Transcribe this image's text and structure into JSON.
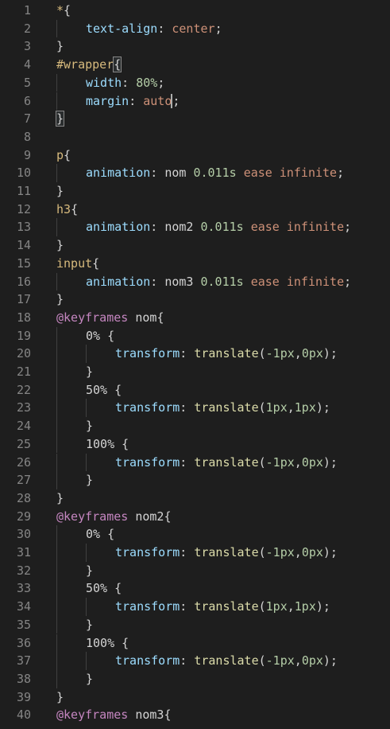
{
  "colors": {
    "background": "#1e1e1e",
    "line_number": "#858585",
    "selector": "#d7ba7d",
    "property": "#9cdcfe",
    "value": "#ce9178",
    "number": "#b5cea8",
    "keyword": "#c586c0",
    "function": "#dcdcaa",
    "punctuation": "#d4d4d4"
  },
  "lines": [
    {
      "n": "1",
      "indent": 0,
      "tokens": [
        [
          "selector",
          "*"
        ],
        [
          "punc",
          "{"
        ]
      ]
    },
    {
      "n": "2",
      "indent": 1,
      "tokens": [
        [
          "prop",
          "text-align"
        ],
        [
          "punc",
          ": "
        ],
        [
          "value",
          "center"
        ],
        [
          "punc",
          ";"
        ]
      ]
    },
    {
      "n": "3",
      "indent": 0,
      "tokens": [
        [
          "punc",
          "}"
        ]
      ]
    },
    {
      "n": "4",
      "indent": 0,
      "tokens": [
        [
          "selector",
          "#wrapper"
        ],
        [
          "punc",
          "{"
        ]
      ],
      "bracket_match": true
    },
    {
      "n": "5",
      "indent": 1,
      "tokens": [
        [
          "prop",
          "width"
        ],
        [
          "punc",
          ": "
        ],
        [
          "number",
          "80%"
        ],
        [
          "punc",
          ";"
        ]
      ]
    },
    {
      "n": "6",
      "indent": 1,
      "tokens": [
        [
          "prop",
          "margin"
        ],
        [
          "punc",
          ": "
        ],
        [
          "value",
          "auto"
        ],
        [
          "punc",
          ";"
        ]
      ],
      "cursor_after": 4
    },
    {
      "n": "7",
      "indent": 0,
      "tokens": [
        [
          "punc",
          "}"
        ]
      ],
      "bracket_match": true
    },
    {
      "n": "8",
      "indent": 0,
      "tokens": []
    },
    {
      "n": "9",
      "indent": 0,
      "tokens": [
        [
          "tag",
          "p"
        ],
        [
          "punc",
          "{"
        ]
      ]
    },
    {
      "n": "10",
      "indent": 1,
      "tokens": [
        [
          "prop",
          "animation"
        ],
        [
          "punc",
          ": "
        ],
        [
          "default",
          "nom "
        ],
        [
          "number",
          "0.011s"
        ],
        [
          "default",
          " "
        ],
        [
          "value",
          "ease"
        ],
        [
          "default",
          " "
        ],
        [
          "value",
          "infinite"
        ],
        [
          "punc",
          ";"
        ]
      ]
    },
    {
      "n": "11",
      "indent": 0,
      "tokens": [
        [
          "punc",
          "}"
        ]
      ]
    },
    {
      "n": "12",
      "indent": 0,
      "tokens": [
        [
          "tag",
          "h3"
        ],
        [
          "punc",
          "{"
        ]
      ]
    },
    {
      "n": "13",
      "indent": 1,
      "tokens": [
        [
          "prop",
          "animation"
        ],
        [
          "punc",
          ": "
        ],
        [
          "default",
          "nom2 "
        ],
        [
          "number",
          "0.011s"
        ],
        [
          "default",
          " "
        ],
        [
          "value",
          "ease"
        ],
        [
          "default",
          " "
        ],
        [
          "value",
          "infinite"
        ],
        [
          "punc",
          ";"
        ]
      ]
    },
    {
      "n": "14",
      "indent": 0,
      "tokens": [
        [
          "punc",
          "}"
        ]
      ]
    },
    {
      "n": "15",
      "indent": 0,
      "tokens": [
        [
          "tag",
          "input"
        ],
        [
          "punc",
          "{"
        ]
      ]
    },
    {
      "n": "16",
      "indent": 1,
      "tokens": [
        [
          "prop",
          "animation"
        ],
        [
          "punc",
          ": "
        ],
        [
          "default",
          "nom3 "
        ],
        [
          "number",
          "0.011s"
        ],
        [
          "default",
          " "
        ],
        [
          "value",
          "ease"
        ],
        [
          "default",
          " "
        ],
        [
          "value",
          "infinite"
        ],
        [
          "punc",
          ";"
        ]
      ]
    },
    {
      "n": "17",
      "indent": 0,
      "tokens": [
        [
          "punc",
          "}"
        ]
      ]
    },
    {
      "n": "18",
      "indent": 0,
      "tokens": [
        [
          "keyword",
          "@keyframes"
        ],
        [
          "default",
          " nom"
        ],
        [
          "punc",
          "{"
        ]
      ]
    },
    {
      "n": "19",
      "indent": 1,
      "tokens": [
        [
          "default",
          "0% "
        ],
        [
          "punc",
          "{"
        ]
      ]
    },
    {
      "n": "20",
      "indent": 2,
      "tokens": [
        [
          "prop",
          "transform"
        ],
        [
          "punc",
          ": "
        ],
        [
          "func",
          "translate"
        ],
        [
          "punc",
          "("
        ],
        [
          "number",
          "-1px"
        ],
        [
          "punc",
          ","
        ],
        [
          "number",
          "0px"
        ],
        [
          "punc",
          ");"
        ]
      ]
    },
    {
      "n": "21",
      "indent": 1,
      "tokens": [
        [
          "punc",
          "}"
        ]
      ]
    },
    {
      "n": "22",
      "indent": 1,
      "tokens": [
        [
          "default",
          "50% "
        ],
        [
          "punc",
          "{"
        ]
      ]
    },
    {
      "n": "23",
      "indent": 2,
      "tokens": [
        [
          "prop",
          "transform"
        ],
        [
          "punc",
          ": "
        ],
        [
          "func",
          "translate"
        ],
        [
          "punc",
          "("
        ],
        [
          "number",
          "1px"
        ],
        [
          "punc",
          ","
        ],
        [
          "number",
          "1px"
        ],
        [
          "punc",
          ");"
        ]
      ]
    },
    {
      "n": "24",
      "indent": 1,
      "tokens": [
        [
          "punc",
          "}"
        ]
      ]
    },
    {
      "n": "25",
      "indent": 1,
      "tokens": [
        [
          "default",
          "100% "
        ],
        [
          "punc",
          "{"
        ]
      ]
    },
    {
      "n": "26",
      "indent": 2,
      "tokens": [
        [
          "prop",
          "transform"
        ],
        [
          "punc",
          ": "
        ],
        [
          "func",
          "translate"
        ],
        [
          "punc",
          "("
        ],
        [
          "number",
          "-1px"
        ],
        [
          "punc",
          ","
        ],
        [
          "number",
          "0px"
        ],
        [
          "punc",
          ");"
        ]
      ]
    },
    {
      "n": "27",
      "indent": 1,
      "tokens": [
        [
          "punc",
          "}"
        ]
      ]
    },
    {
      "n": "28",
      "indent": 0,
      "tokens": [
        [
          "punc",
          "}"
        ]
      ]
    },
    {
      "n": "29",
      "indent": 0,
      "tokens": [
        [
          "keyword",
          "@keyframes"
        ],
        [
          "default",
          " nom2"
        ],
        [
          "punc",
          "{"
        ]
      ]
    },
    {
      "n": "30",
      "indent": 1,
      "tokens": [
        [
          "default",
          "0% "
        ],
        [
          "punc",
          "{"
        ]
      ]
    },
    {
      "n": "31",
      "indent": 2,
      "tokens": [
        [
          "prop",
          "transform"
        ],
        [
          "punc",
          ": "
        ],
        [
          "func",
          "translate"
        ],
        [
          "punc",
          "("
        ],
        [
          "number",
          "-1px"
        ],
        [
          "punc",
          ","
        ],
        [
          "number",
          "0px"
        ],
        [
          "punc",
          ");"
        ]
      ]
    },
    {
      "n": "32",
      "indent": 1,
      "tokens": [
        [
          "punc",
          "}"
        ]
      ]
    },
    {
      "n": "33",
      "indent": 1,
      "tokens": [
        [
          "default",
          "50% "
        ],
        [
          "punc",
          "{"
        ]
      ]
    },
    {
      "n": "34",
      "indent": 2,
      "tokens": [
        [
          "prop",
          "transform"
        ],
        [
          "punc",
          ": "
        ],
        [
          "func",
          "translate"
        ],
        [
          "punc",
          "("
        ],
        [
          "number",
          "1px"
        ],
        [
          "punc",
          ","
        ],
        [
          "number",
          "1px"
        ],
        [
          "punc",
          ");"
        ]
      ]
    },
    {
      "n": "35",
      "indent": 1,
      "tokens": [
        [
          "punc",
          "}"
        ]
      ]
    },
    {
      "n": "36",
      "indent": 1,
      "tokens": [
        [
          "default",
          "100% "
        ],
        [
          "punc",
          "{"
        ]
      ]
    },
    {
      "n": "37",
      "indent": 2,
      "tokens": [
        [
          "prop",
          "transform"
        ],
        [
          "punc",
          ": "
        ],
        [
          "func",
          "translate"
        ],
        [
          "punc",
          "("
        ],
        [
          "number",
          "-1px"
        ],
        [
          "punc",
          ","
        ],
        [
          "number",
          "0px"
        ],
        [
          "punc",
          ");"
        ]
      ]
    },
    {
      "n": "38",
      "indent": 1,
      "tokens": [
        [
          "punc",
          "}"
        ]
      ]
    },
    {
      "n": "39",
      "indent": 0,
      "tokens": [
        [
          "punc",
          "}"
        ]
      ]
    },
    {
      "n": "40",
      "indent": 0,
      "tokens": [
        [
          "keyword",
          "@keyframes"
        ],
        [
          "default",
          " nom3"
        ],
        [
          "punc",
          "{"
        ]
      ]
    }
  ]
}
